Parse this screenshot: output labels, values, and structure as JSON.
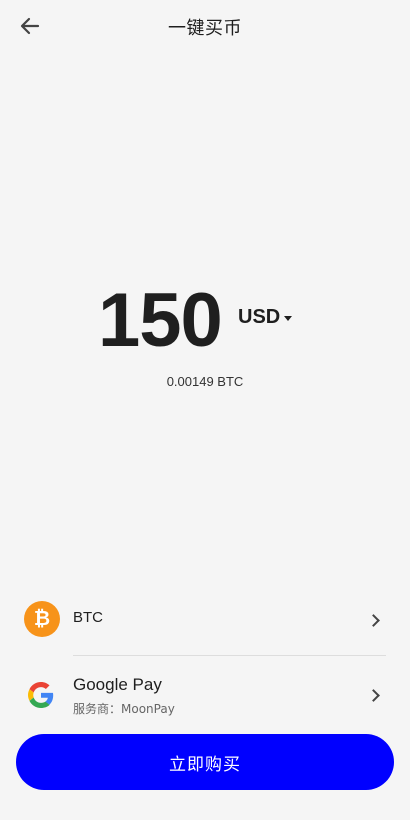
{
  "header": {
    "title": "一键买币",
    "back_icon": "arrow-left-icon"
  },
  "amount": {
    "value": "150",
    "currency": "USD",
    "conversion": "0.00149 BTC"
  },
  "coin_row": {
    "icon": "bitcoin-icon",
    "icon_color": "#f7931a",
    "icon_glyph": "₿",
    "label": "BTC"
  },
  "payment_row": {
    "icon": "google-icon",
    "label": "Google Pay",
    "provider": "服务商：MoonPay"
  },
  "buy_button": {
    "label": "立即购买",
    "color": "#0000ff"
  }
}
